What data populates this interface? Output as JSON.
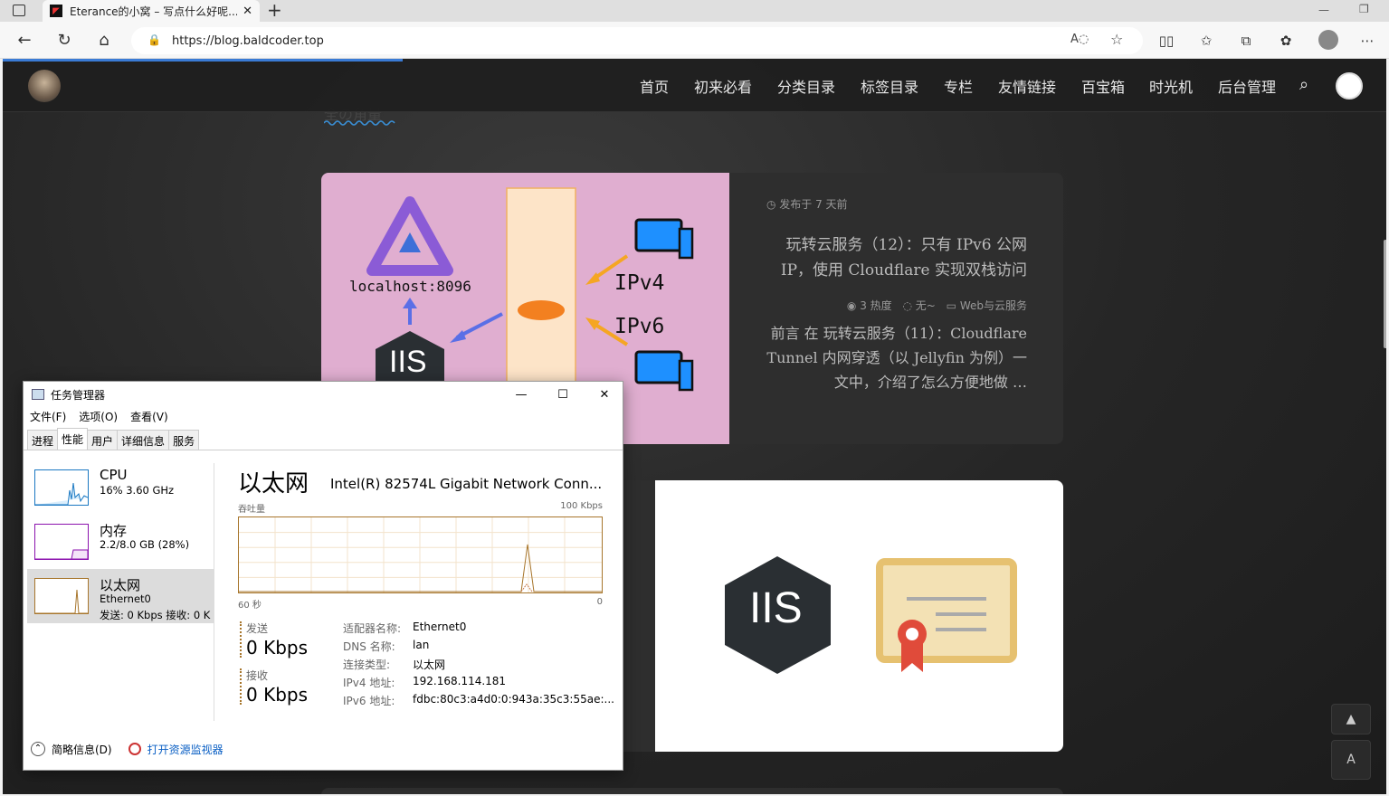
{
  "browser": {
    "tab_title": "Eterance的小窝 – 写点什么好呢...",
    "tab_close": "✕",
    "new_tab": "+",
    "url": "https://blog.baldcoder.top"
  },
  "site": {
    "nav": [
      "首页",
      "初来必看",
      "分类目录",
      "标签目录",
      "专栏",
      "友情链接",
      "百宝箱",
      "时光机",
      "后台管理"
    ],
    "section_title": "全の角量"
  },
  "post1": {
    "date": "发布于 7 天前",
    "title": "玩转云服务（12）：只有 IPv6 公网 IP，使用 Cloudflare 实现双栈访问",
    "views": "3 热度",
    "comments": "无~",
    "category": "Web与云服务",
    "excerpt": "前言 在 玩转云服务（11）：Cloudflare Tunnel 内网穿透（以 Jellyfin 为例）一文中，介绍了怎么方便地做 …",
    "img_localhost": "localhost:8096",
    "img_iis": "IIS",
    "img_ipv4": "IPv4",
    "img_ipv6": "IPv6"
  },
  "post2": {
    "img_iis": "IIS"
  },
  "taskmanager": {
    "title": "任务管理器",
    "menu": [
      "文件(F)",
      "选项(O)",
      "查看(V)"
    ],
    "tabs": [
      "进程",
      "性能",
      "用户",
      "详细信息",
      "服务"
    ],
    "active_tab": "性能",
    "sidebar": [
      {
        "name": "CPU",
        "sub": "16% 3.60 GHz",
        "sub2": ""
      },
      {
        "name": "内存",
        "sub": "2.2/8.0 GB (28%)",
        "sub2": ""
      },
      {
        "name": "以太网",
        "sub": "Ethernet0",
        "sub2": "发送: 0 Kbps 接收: 0 K"
      }
    ],
    "net_title": "以太网",
    "net_model": "Intel(R) 82574L Gigabit Network Conn...",
    "graph_label": "吞吐量",
    "graph_max": "100 Kbps",
    "graph_left": "60 秒",
    "graph_right": "0",
    "send_label": "发送",
    "send_value": "0 Kbps",
    "recv_label": "接收",
    "recv_value": "0 Kbps",
    "details": [
      {
        "k": "适配器名称:",
        "v": "Ethernet0"
      },
      {
        "k": "DNS 名称:",
        "v": "lan"
      },
      {
        "k": "连接类型:",
        "v": "以太网"
      },
      {
        "k": "IPv4 地址:",
        "v": "192.168.114.181"
      },
      {
        "k": "IPv6 地址:",
        "v": "fdbc:80c3:a4d0:0:943a:35c3:55ae:..."
      }
    ],
    "footer_brief": "简略信息(D)",
    "footer_monitor": "打开资源监视器",
    "colors": {
      "cpu": "#1a78c2",
      "memory": "#8b12ae",
      "ethernet": "#a7752b"
    }
  }
}
